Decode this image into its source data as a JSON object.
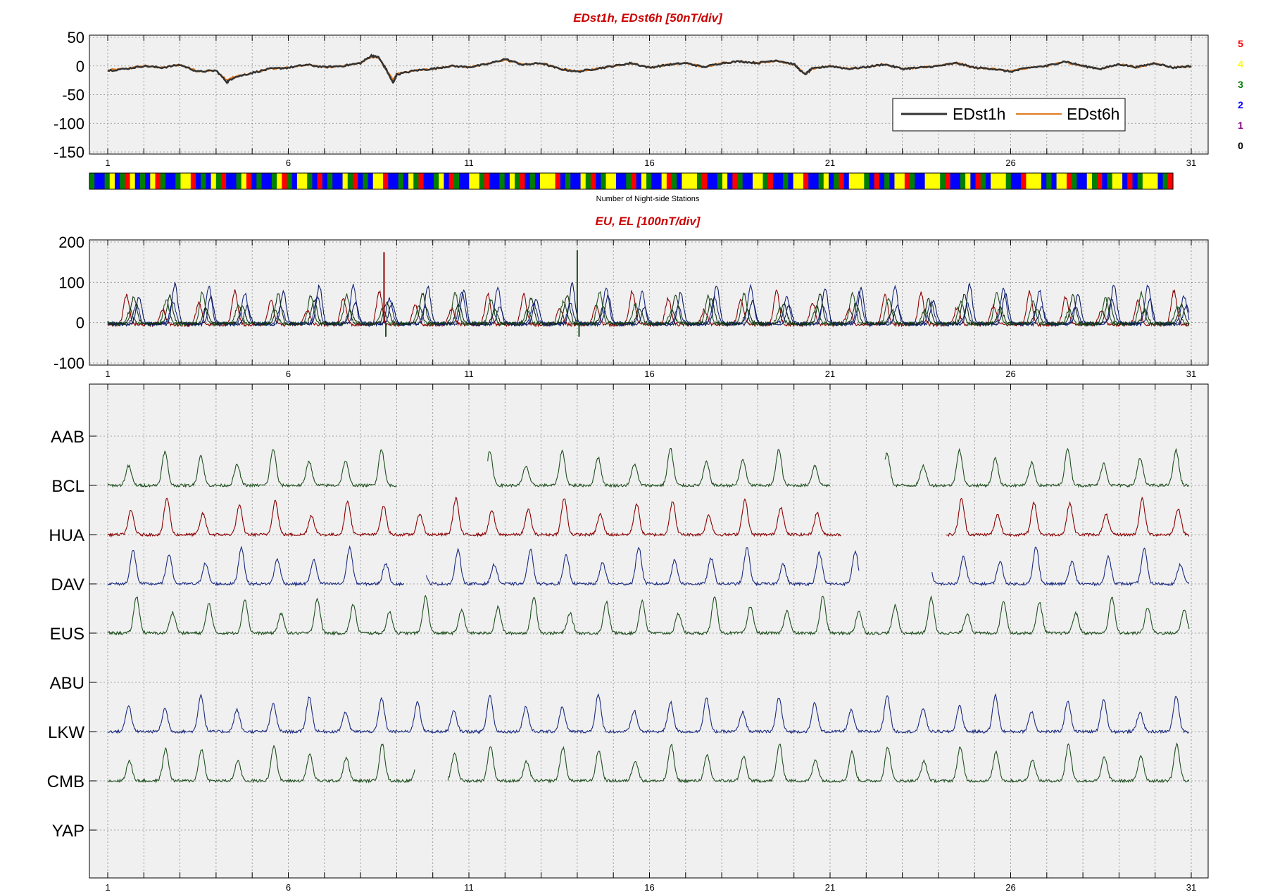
{
  "chart_data": [
    {
      "type": "line",
      "title": "EDst1h, EDst6h [50nT/div]",
      "x_ticks": [
        "1",
        "6",
        "11",
        "16",
        "21",
        "26",
        "31"
      ],
      "xlim": [
        1,
        31
      ],
      "y_ticks": [
        "50",
        "0",
        "-50",
        "-100",
        "-150"
      ],
      "ylim": [
        -150,
        50
      ],
      "grid": true,
      "legend_placement": "lower-right",
      "series": [
        {
          "name": "EDst1h",
          "color": "#333333",
          "x": [
            1,
            1.5,
            2,
            2.5,
            3,
            3.5,
            4,
            4.3,
            4.5,
            5,
            5.5,
            6,
            6.5,
            7,
            7.5,
            8,
            8.3,
            8.5,
            8.7,
            8.9,
            9,
            9.5,
            10,
            10.5,
            11,
            11.5,
            12,
            12.5,
            13,
            13.5,
            14,
            14.5,
            15,
            15.5,
            16,
            16.5,
            17,
            17.5,
            18,
            18.5,
            19,
            19.5,
            20,
            20.3,
            20.5,
            21,
            21.5,
            22,
            22.5,
            23,
            23.5,
            24,
            24.5,
            25,
            25.5,
            26,
            26.5,
            27,
            27.5,
            28,
            28.5,
            29,
            29.5,
            30,
            30.5,
            31
          ],
          "y": [
            -8,
            -5,
            0,
            -3,
            2,
            -10,
            -8,
            -28,
            -20,
            -12,
            -5,
            -3,
            2,
            -2,
            0,
            5,
            18,
            15,
            -5,
            -30,
            -15,
            -8,
            -5,
            0,
            -2,
            3,
            12,
            2,
            5,
            -5,
            -10,
            -5,
            0,
            5,
            -3,
            2,
            5,
            -2,
            5,
            8,
            5,
            10,
            3,
            -15,
            -5,
            0,
            -5,
            -2,
            3,
            -5,
            -3,
            0,
            5,
            -3,
            -5,
            -10,
            -3,
            0,
            8,
            0,
            -5,
            3,
            -2,
            5,
            -3,
            0
          ]
        },
        {
          "name": "EDst6h",
          "color": "#e07a1f",
          "x": [
            1,
            1.5,
            2,
            2.5,
            3,
            3.5,
            4,
            4.3,
            4.5,
            5,
            5.5,
            6,
            6.5,
            7,
            7.5,
            8,
            8.3,
            8.5,
            8.7,
            8.9,
            9,
            9.5,
            10,
            10.5,
            11,
            11.5,
            12,
            12.5,
            13,
            13.5,
            14,
            14.5,
            15,
            15.5,
            16,
            16.5,
            17,
            17.5,
            18,
            18.5,
            19,
            19.5,
            20,
            20.3,
            20.5,
            21,
            21.5,
            22,
            22.5,
            23,
            23.5,
            24,
            24.5,
            25,
            25.5,
            26,
            26.5,
            27,
            27.5,
            28,
            28.5,
            29,
            29.5,
            30,
            30.5,
            31
          ],
          "y": [
            -7,
            -5,
            0,
            -3,
            2,
            -9,
            -8,
            -25,
            -19,
            -12,
            -5,
            -3,
            2,
            -2,
            0,
            5,
            16,
            14,
            -5,
            -25,
            -14,
            -8,
            -5,
            0,
            -2,
            3,
            11,
            2,
            5,
            -5,
            -9,
            -5,
            0,
            5,
            -3,
            2,
            5,
            -2,
            5,
            8,
            5,
            9,
            3,
            -14,
            -5,
            0,
            -5,
            -2,
            3,
            -5,
            -3,
            0,
            5,
            -3,
            -5,
            -9,
            -3,
            0,
            7,
            0,
            -5,
            3,
            -2,
            5,
            -3,
            0
          ]
        }
      ]
    },
    {
      "type": "heatmap",
      "caption": "Number of Night-side Stations",
      "x_ticks": [
        "1",
        "6",
        "11",
        "16",
        "21",
        "26",
        "31"
      ],
      "xlim": [
        1,
        31
      ],
      "color_scale": [
        {
          "label": "5",
          "color": "#ff0000"
        },
        {
          "label": "4",
          "color": "#ffff00"
        },
        {
          "label": "3",
          "color": "#007f00"
        },
        {
          "label": "2",
          "color": "#0000ff"
        },
        {
          "label": "1",
          "color": "#7f007f"
        },
        {
          "label": "0",
          "color": "#000000"
        }
      ],
      "counts": [
        3,
        2,
        2,
        3,
        4,
        2,
        3,
        5,
        4,
        2,
        3,
        2,
        4,
        5,
        3,
        2,
        2,
        3,
        4,
        4,
        5,
        2,
        3,
        2,
        4,
        3,
        5,
        2,
        2,
        3,
        4,
        5,
        2,
        3,
        2,
        2,
        3,
        4,
        5,
        3,
        2,
        4,
        4,
        3,
        2,
        5,
        2,
        3,
        2,
        2,
        4,
        3,
        5,
        2,
        3,
        2,
        4,
        4,
        5,
        2,
        2,
        3,
        2,
        4,
        3,
        5,
        2,
        2,
        3,
        4,
        2,
        5,
        3,
        2,
        2,
        4,
        4,
        3,
        5,
        2,
        2,
        3,
        2,
        4,
        3,
        5,
        2,
        3,
        2,
        4,
        4,
        4,
        5,
        2,
        3,
        2,
        2,
        4,
        3,
        5,
        2,
        3,
        4,
        4,
        2,
        2,
        3,
        5,
        2,
        4,
        3,
        2,
        2,
        4,
        5,
        3,
        2,
        4,
        4,
        4,
        3,
        5,
        2,
        2,
        3,
        4,
        2,
        5,
        3,
        2,
        2,
        4,
        4,
        3,
        5,
        2,
        2,
        3,
        2,
        4,
        4,
        5,
        2,
        2,
        3,
        4,
        2,
        3,
        5,
        2,
        4,
        4,
        4,
        3,
        2,
        5,
        2,
        3,
        2,
        4,
        4,
        5,
        3,
        2,
        2,
        4,
        4,
        4,
        3,
        5,
        2,
        2,
        3,
        4,
        2,
        5,
        3,
        2,
        4,
        4,
        4,
        3,
        2,
        2,
        5,
        4,
        4,
        4,
        2,
        3,
        2,
        4,
        4,
        5,
        3,
        2,
        2,
        4,
        3,
        5,
        2,
        3,
        4,
        4,
        2,
        5,
        2,
        3,
        4,
        4,
        4,
        2,
        3,
        5
      ]
    },
    {
      "type": "line",
      "title": "EU, EL   [100nT/div]",
      "x_ticks": [
        "1",
        "6",
        "11",
        "16",
        "21",
        "26",
        "31"
      ],
      "xlim": [
        1,
        31
      ],
      "y_ticks": [
        "200",
        "100",
        "0",
        "-100"
      ],
      "ylim": [
        -100,
        200
      ],
      "grid": true,
      "series": [
        {
          "color": "#8b0000",
          "phase": 0.02,
          "amplitude": 80,
          "base": -5
        },
        {
          "color": "#1a2a80",
          "phase": 0.3,
          "amplitude": 90,
          "base": -2
        },
        {
          "color": "#1f4f1f",
          "phase": 0.12,
          "amplitude": 75,
          "base": -3
        },
        {
          "color": "#0a1a60",
          "phase": 0.36,
          "amplitude": 95,
          "base": -4
        },
        {
          "color": "#153315",
          "phase": 0.22,
          "amplitude": 70,
          "base": -2
        }
      ],
      "spikes": [
        {
          "day": 8.65,
          "value": 175,
          "color": "#8b0000"
        },
        {
          "day": 8.7,
          "value": -35,
          "color": "#1f4f1f"
        },
        {
          "day": 14.0,
          "value": 180,
          "color": "#1f4f1f"
        },
        {
          "day": 14.05,
          "value": -35,
          "color": "#1f4f1f"
        }
      ]
    },
    {
      "type": "line",
      "x_ticks": [
        "1",
        "6",
        "11",
        "16",
        "21",
        "26",
        "31"
      ],
      "xlim": [
        1,
        31
      ],
      "grid": true,
      "stations": [
        {
          "name": "AAB",
          "color": "#1f4f1f",
          "phase": 0.05,
          "gaps": []
        },
        {
          "name": "BCL",
          "color": "#1f4f1f",
          "phase": 0.08,
          "gaps": [
            [
              9,
              11.5
            ],
            [
              21,
              22.5
            ]
          ]
        },
        {
          "name": "HUA",
          "color": "#8b0000",
          "phase": 0.14,
          "gaps": [
            [
              21.3,
              24.2
            ]
          ]
        },
        {
          "name": "DAV",
          "color": "#1a2a80",
          "phase": 0.2,
          "gaps": [
            [
              9.2,
              9.8
            ],
            [
              21.8,
              23.8
            ]
          ]
        },
        {
          "name": "EUS",
          "color": "#1f4f1f",
          "phase": 0.3,
          "gaps": []
        },
        {
          "name": "ABU",
          "color": "#1a2a80",
          "phase": 0.05,
          "gaps": []
        },
        {
          "name": "LKW",
          "color": "#1a2a80",
          "phase": 0.08,
          "gaps": []
        },
        {
          "name": "CMB",
          "color": "#1f4f1f",
          "phase": 0.1,
          "gaps": [
            [
              9.5,
              10.4
            ]
          ]
        },
        {
          "name": "YAP",
          "color": "#1f4f1f",
          "phase": 0.0,
          "gaps": []
        }
      ]
    }
  ]
}
